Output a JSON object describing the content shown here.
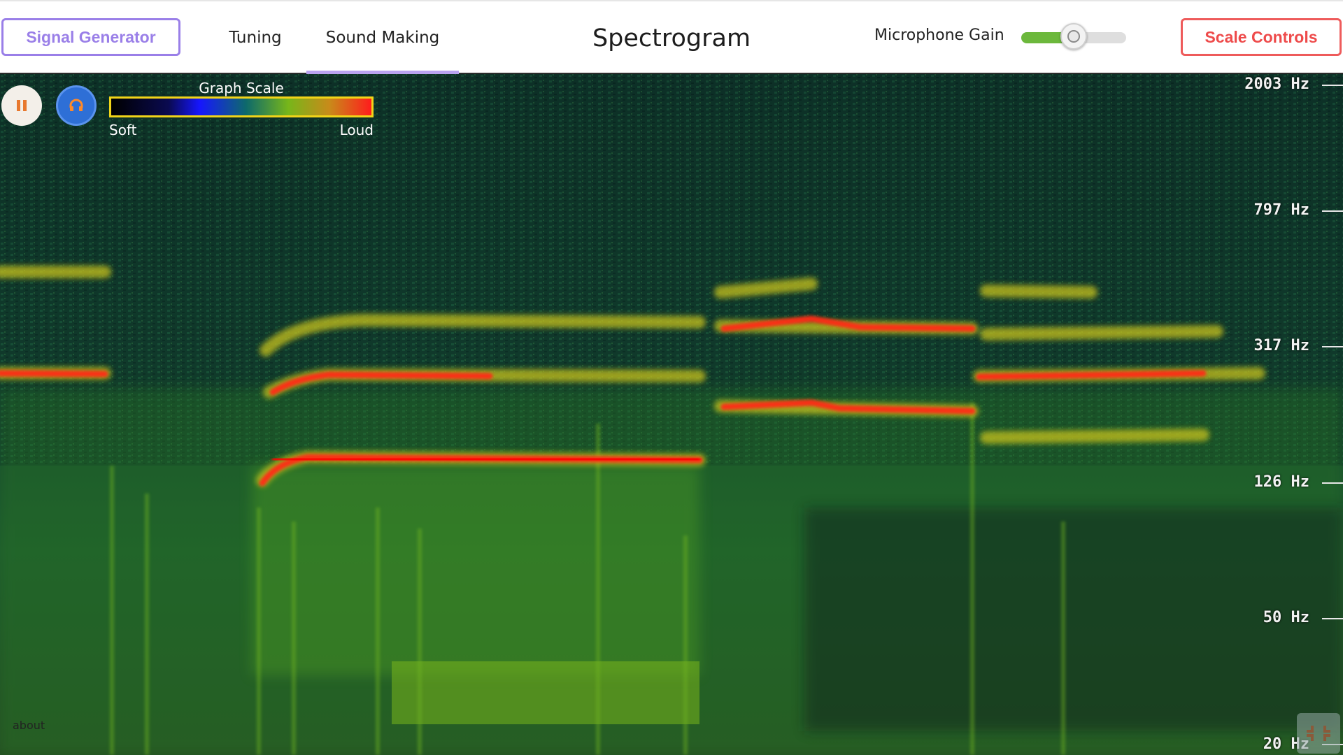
{
  "header": {
    "signal_generator_label": "Signal Generator",
    "tabs": [
      {
        "label": "Tuning"
      },
      {
        "label": "Sound Making"
      }
    ],
    "title": "Spectrogram",
    "microphone_gain_label": "Microphone Gain",
    "microphone_gain_level": 0.5,
    "scale_controls_label": "Scale Controls"
  },
  "graph_scale": {
    "title": "Graph Scale",
    "soft_label": "Soft",
    "loud_label": "Loud"
  },
  "frequency_axis": [
    {
      "label": "2003 Hz"
    },
    {
      "label": "797 Hz"
    },
    {
      "label": "317 Hz"
    },
    {
      "label": "126 Hz"
    },
    {
      "label": "50 Hz"
    },
    {
      "label": "20 Hz"
    }
  ],
  "footer": {
    "about_label": "about"
  },
  "icons": {
    "pause": "pause-icon",
    "listen": "headphones-icon",
    "fullscreen": "fullscreen-icon"
  },
  "colors": {
    "signal_generator_accent": "#9a7fe8",
    "scale_controls_accent": "#ee4b4b",
    "gain_fill": "#6cb83c",
    "scale_border": "#f1d419"
  }
}
